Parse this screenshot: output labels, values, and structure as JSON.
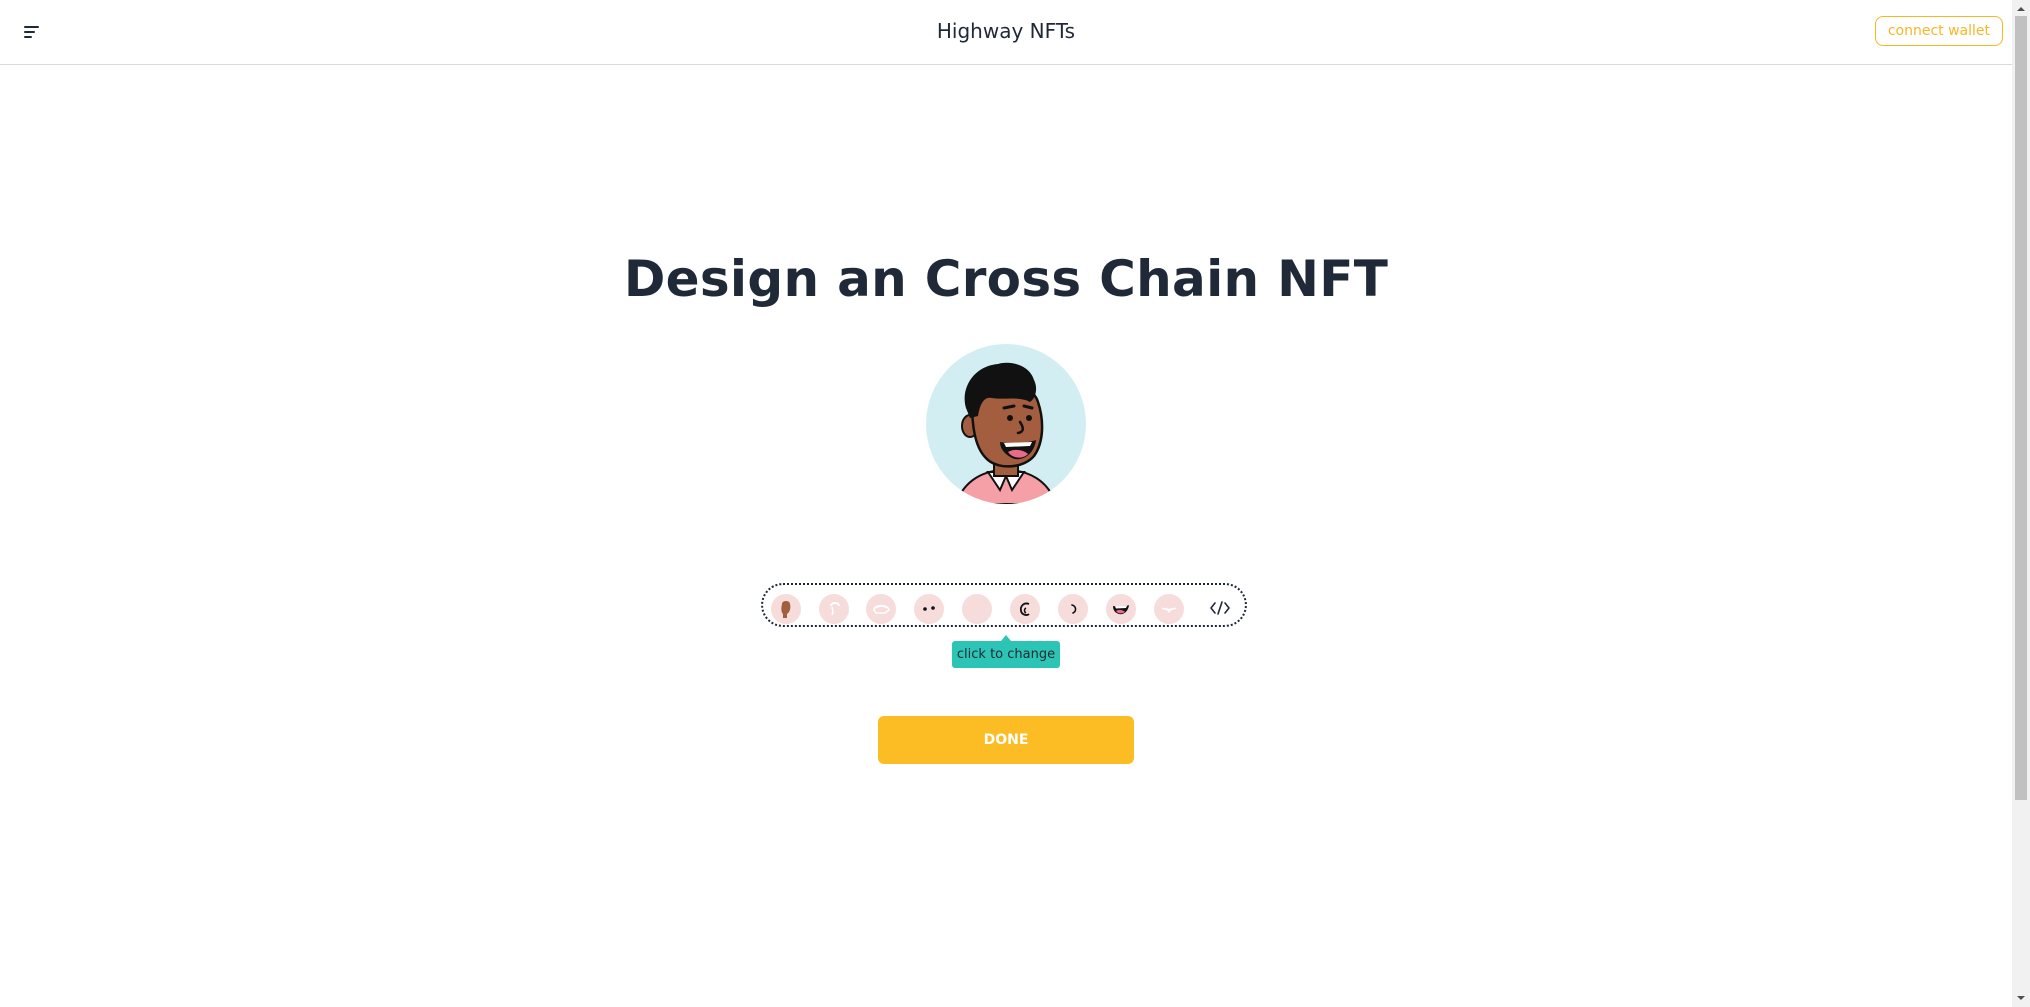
{
  "header": {
    "menu_icon": "hamburger-menu-icon",
    "title": "Highway NFTs",
    "connect_wallet_label": "connect wallet"
  },
  "main": {
    "heading": "Design an Cross Chain NFT",
    "avatar_icon": "avatar-face-icon",
    "toolbar": {
      "items": [
        {
          "name": "face-shape",
          "icon": "face-icon"
        },
        {
          "name": "ear",
          "icon": "ear-icon"
        },
        {
          "name": "hair",
          "icon": "hair-icon"
        },
        {
          "name": "eyes",
          "icon": "eyes-icon"
        },
        {
          "name": "eyebrows",
          "icon": "eyebrows-icon"
        },
        {
          "name": "glasses",
          "icon": "glasses-icon"
        },
        {
          "name": "nose",
          "icon": "nose-icon"
        },
        {
          "name": "mouth",
          "icon": "mouth-icon"
        },
        {
          "name": "shirt",
          "icon": "shirt-icon"
        }
      ],
      "code_icon": "code-icon"
    },
    "tooltip": "click to change",
    "done_label": "DONE"
  },
  "colors": {
    "accent": "#fbbd23",
    "tooltip": "#2cc5b5",
    "avatar_bg": "#d3eef2",
    "tool_bg": "#f7dcdc",
    "text": "#1f2937"
  }
}
